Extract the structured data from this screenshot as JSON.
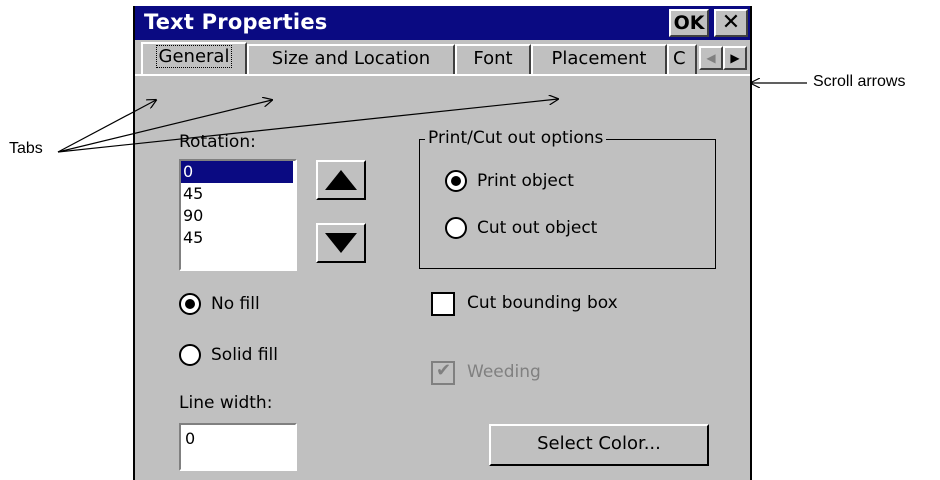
{
  "window": {
    "title": "Text Properties",
    "ok_label": "OK",
    "close_label": "✕"
  },
  "tabs": [
    {
      "label": "General",
      "active": true
    },
    {
      "label": "Size and Location",
      "active": false
    },
    {
      "label": "Font",
      "active": false
    },
    {
      "label": "Placement",
      "active": false
    },
    {
      "label": "C",
      "active": false
    }
  ],
  "scroll": {
    "left_icon": "left-arrow-icon",
    "right_icon": "right-arrow-icon"
  },
  "rotation": {
    "label": "Rotation:",
    "items": [
      "0",
      "45",
      "90",
      "45"
    ],
    "selected": "0"
  },
  "print_cut": {
    "legend": "Print/Cut out options",
    "print_label": "Print object",
    "cut_label": "Cut out object",
    "selected": "print"
  },
  "fill": {
    "no_fill_label": "No fill",
    "solid_fill_label": "Solid fill",
    "selected": "no_fill"
  },
  "options": {
    "cut_bounding_box_label": "Cut bounding box",
    "cut_bounding_box_checked": false,
    "weeding_label": "Weeding",
    "weeding_checked": true,
    "weeding_disabled": true
  },
  "line_width": {
    "label": "Line width:",
    "value": "0"
  },
  "select_color_label": "Select Color...",
  "annotations": {
    "tabs": "Tabs",
    "scroll_arrows": "Scroll arrows"
  }
}
